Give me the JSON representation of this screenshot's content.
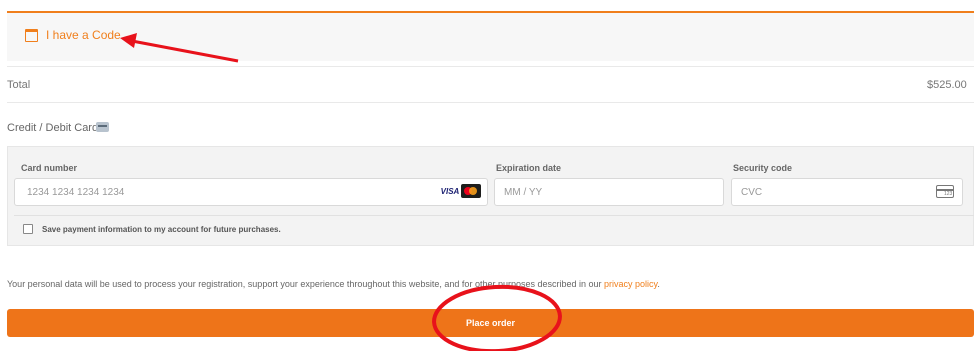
{
  "coupon": {
    "link_text": "I have a Code",
    "icon": "calendar-icon"
  },
  "order_total": {
    "label": "Total",
    "value": "$525.00"
  },
  "payment_method": {
    "label": "Credit / Debit Card",
    "icon": "credit-card-icon"
  },
  "card_form": {
    "card_number": {
      "label": "Card number",
      "placeholder": "1234 1234 1234 1234",
      "brand_icons": [
        "visa-logo",
        "mastercard-logo"
      ]
    },
    "expiration": {
      "label": "Expiration date",
      "placeholder": "MM / YY"
    },
    "security_code": {
      "label": "Security code",
      "placeholder": "CVC",
      "icon": "cvc-card-icon"
    },
    "save_info_label": "Save payment information to my account for future purchases."
  },
  "privacy": {
    "text": "Your personal data will be used to process your registration, support your experience throughout this website, and for other purposes described in our ",
    "link_text": "privacy policy",
    "suffix": "."
  },
  "place_order_label": "Place order",
  "colors": {
    "accent": "#ee7419",
    "annotation": "#e8121b"
  }
}
